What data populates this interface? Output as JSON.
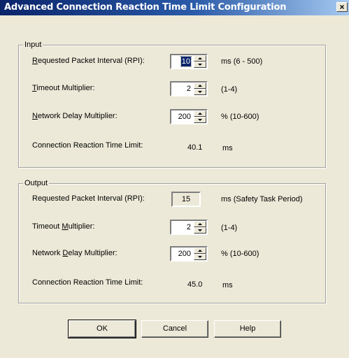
{
  "window": {
    "title": "Advanced Connection Reaction Time Limit Configuration",
    "close_glyph": "×"
  },
  "input_group": {
    "legend": "Input",
    "rpi": {
      "pre": "",
      "acc": "R",
      "post": "equested Packet Interval (RPI):",
      "value": "10",
      "unit": "ms (6 - 500)"
    },
    "timeout": {
      "pre": "",
      "acc": "T",
      "post": "imeout Multiplier:",
      "value": "2",
      "unit": "(1-4)"
    },
    "network": {
      "pre": "",
      "acc": "N",
      "post": "etwork Delay Multiplier:",
      "value": "200",
      "unit": "% (10-600)"
    },
    "crtl": {
      "label": "Connection Reaction Time Limit:",
      "value": "40.1",
      "unit": "ms"
    }
  },
  "output_group": {
    "legend": "Output",
    "rpi": {
      "label": "Requested Packet Interval (RPI):",
      "value": "15",
      "unit": "ms (Safety Task Period)"
    },
    "timeout": {
      "pre": "Timeout ",
      "acc": "M",
      "post": "ultiplier:",
      "value": "2",
      "unit": "(1-4)"
    },
    "network": {
      "pre": "Network ",
      "acc": "D",
      "post": "elay Multiplier:",
      "value": "200",
      "unit": "% (10-600)"
    },
    "crtl": {
      "label": "Connection Reaction Time Limit:",
      "value": "45.0",
      "unit": "ms"
    }
  },
  "buttons": {
    "ok": "OK",
    "cancel": "Cancel",
    "help": "Help"
  }
}
